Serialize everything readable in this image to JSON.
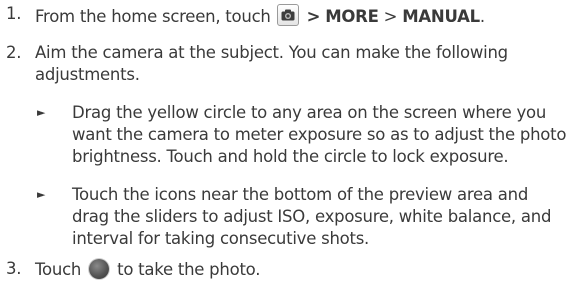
{
  "steps": [
    {
      "number": "1.",
      "text_before": "From the home screen, touch",
      "icon": "camera-app-icon",
      "path": [
        ">",
        "MORE",
        ">",
        "MANUAL",
        "."
      ]
    },
    {
      "number": "2.",
      "lines": [
        "Aim the camera at the subject. You can make the following",
        "adjustments."
      ],
      "bullets": [
        {
          "symbol": "►",
          "lines": [
            "Drag the yellow circle to any area on the screen where you",
            "want the camera to meter exposure so as to adjust the photo",
            "brightness. Touch and hold the circle to lock exposure."
          ]
        },
        {
          "symbol": "►",
          "lines": [
            "Touch the icons near the bottom of the preview area and",
            "drag the sliders to adjust ISO, exposure, white balance, and",
            "interval for taking consecutive shots."
          ]
        }
      ]
    },
    {
      "number": "3.",
      "text_before": "Touch",
      "icon": "shutter-button-icon",
      "text_after": "to take the photo."
    }
  ]
}
